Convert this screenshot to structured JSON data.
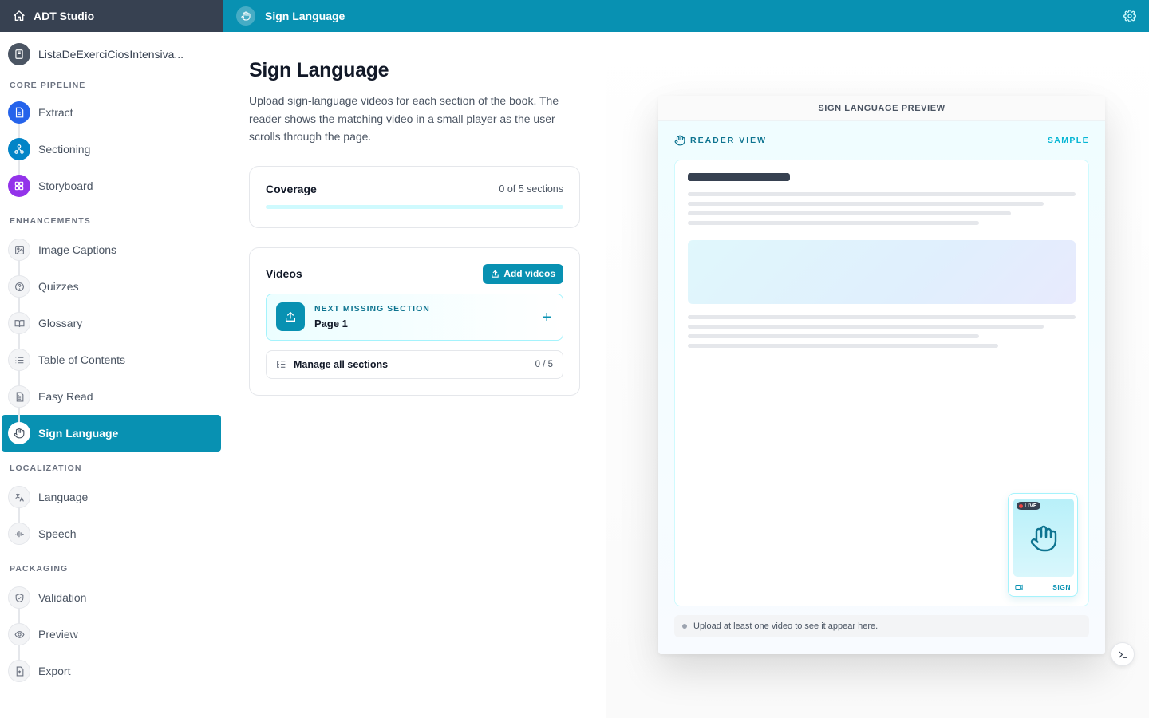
{
  "app": {
    "title": "ADT Studio"
  },
  "book": {
    "name": "ListaDeExerciCiosIntensiva..."
  },
  "sidebar": {
    "groups": [
      {
        "label": "CORE PIPELINE",
        "items": [
          {
            "label": "Extract",
            "icon": "document-icon"
          },
          {
            "label": "Sectioning",
            "icon": "sections-icon"
          },
          {
            "label": "Storyboard",
            "icon": "grid-icon"
          }
        ]
      },
      {
        "label": "ENHANCEMENTS",
        "items": [
          {
            "label": "Image Captions",
            "icon": "image-icon"
          },
          {
            "label": "Quizzes",
            "icon": "question-icon"
          },
          {
            "label": "Glossary",
            "icon": "book-open-icon"
          },
          {
            "label": "Table of Contents",
            "icon": "list-icon"
          },
          {
            "label": "Easy Read",
            "icon": "file-text-icon"
          },
          {
            "label": "Sign Language",
            "icon": "hand-icon",
            "active": true
          }
        ]
      },
      {
        "label": "LOCALIZATION",
        "items": [
          {
            "label": "Language",
            "icon": "translate-icon"
          },
          {
            "label": "Speech",
            "icon": "audio-wave-icon"
          }
        ]
      },
      {
        "label": "PACKAGING",
        "items": [
          {
            "label": "Validation",
            "icon": "shield-icon"
          },
          {
            "label": "Preview",
            "icon": "eye-icon"
          },
          {
            "label": "Export",
            "icon": "export-file-icon"
          }
        ]
      }
    ]
  },
  "topbar": {
    "title": "Sign Language"
  },
  "page": {
    "title": "Sign Language",
    "description": "Upload sign-language videos for each section of the book. The reader shows the matching video in a small player as the user scrolls through the page."
  },
  "coverage": {
    "title": "Coverage",
    "summary": "0 of 5 sections",
    "fraction": 0
  },
  "videos": {
    "title": "Videos",
    "add_label": "Add videos",
    "next_missing_kicker": "NEXT MISSING SECTION",
    "next_missing_page": "Page 1",
    "manage_label": "Manage all sections",
    "manage_count": "0 / 5"
  },
  "preview": {
    "header": "SIGN LANGUAGE PREVIEW",
    "reader_view": "READER VIEW",
    "sample": "SAMPLE",
    "live": "LIVE",
    "sign": "SIGN",
    "hint": "Upload at least one video to see it appear here."
  },
  "colors": {
    "accent": "#0891b2",
    "sidebar_header": "#374151",
    "extract": "#2563eb",
    "sectioning": "#0284c7",
    "storyboard": "#9333ea"
  }
}
